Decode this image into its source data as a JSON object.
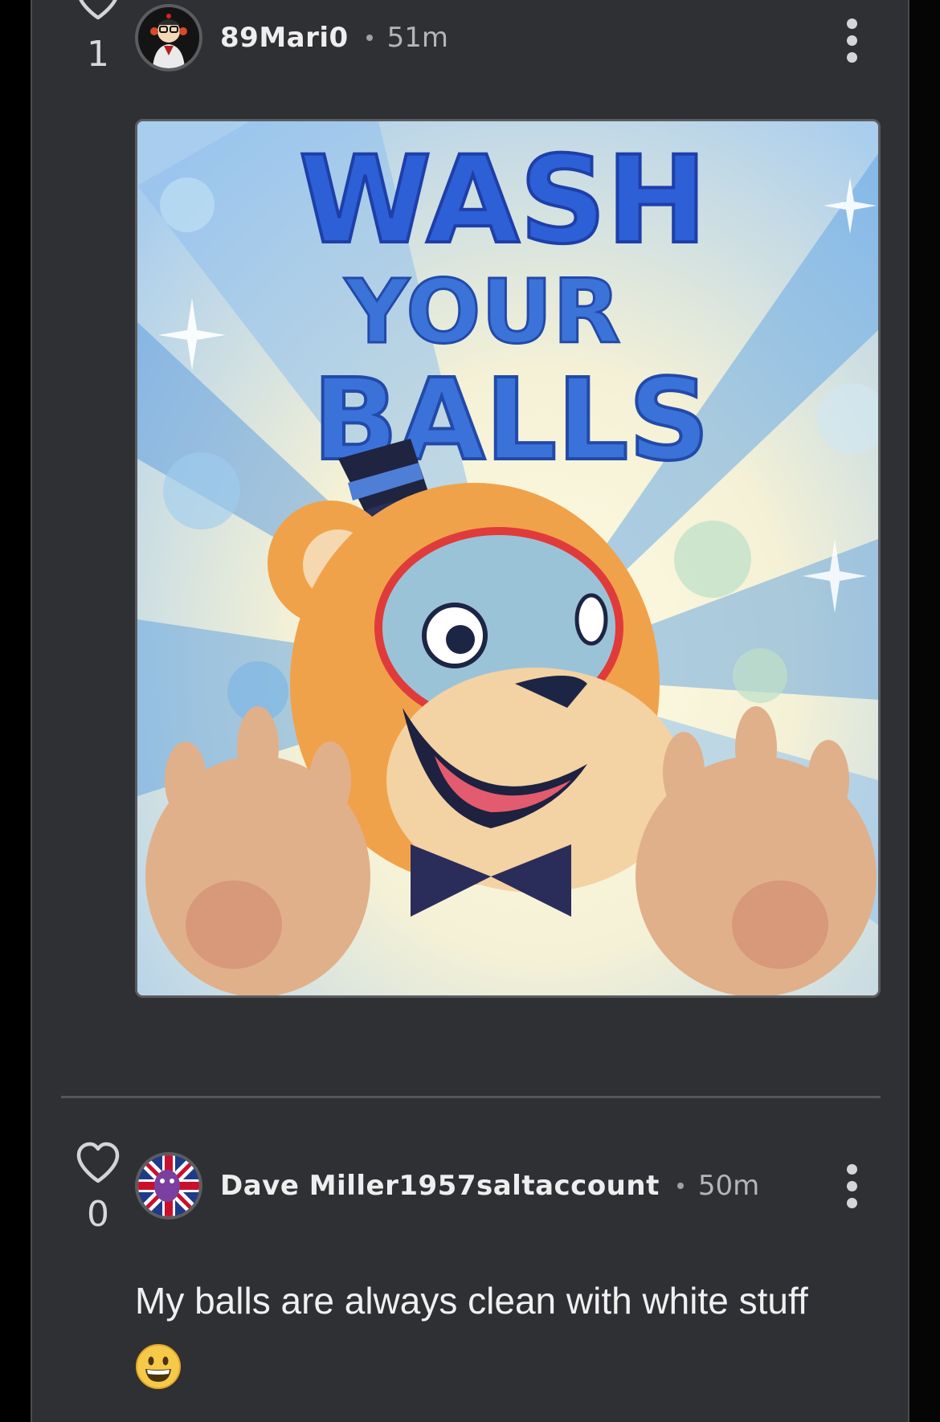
{
  "comments": [
    {
      "vote_count": "1",
      "username": "89Mari0",
      "time": "51m",
      "image_text": {
        "line1": "WASH",
        "line2": "YOUR",
        "line3": "BALLS"
      }
    },
    {
      "vote_count": "0",
      "username": "Dave Miller1957saltaccount",
      "time": "50m",
      "text": "My balls are always clean with white stuff"
    }
  ],
  "colors": {
    "panel_bg": "#2f3033",
    "page_bg": "#000000",
    "text_primary": "#eeeeef",
    "text_secondary": "#b4b5b9",
    "divider": "#55565a"
  },
  "icons": {
    "vote": "heart-outline-icon",
    "menu": "more-vertical-icon",
    "emoji": "grinning-face-emoji"
  }
}
